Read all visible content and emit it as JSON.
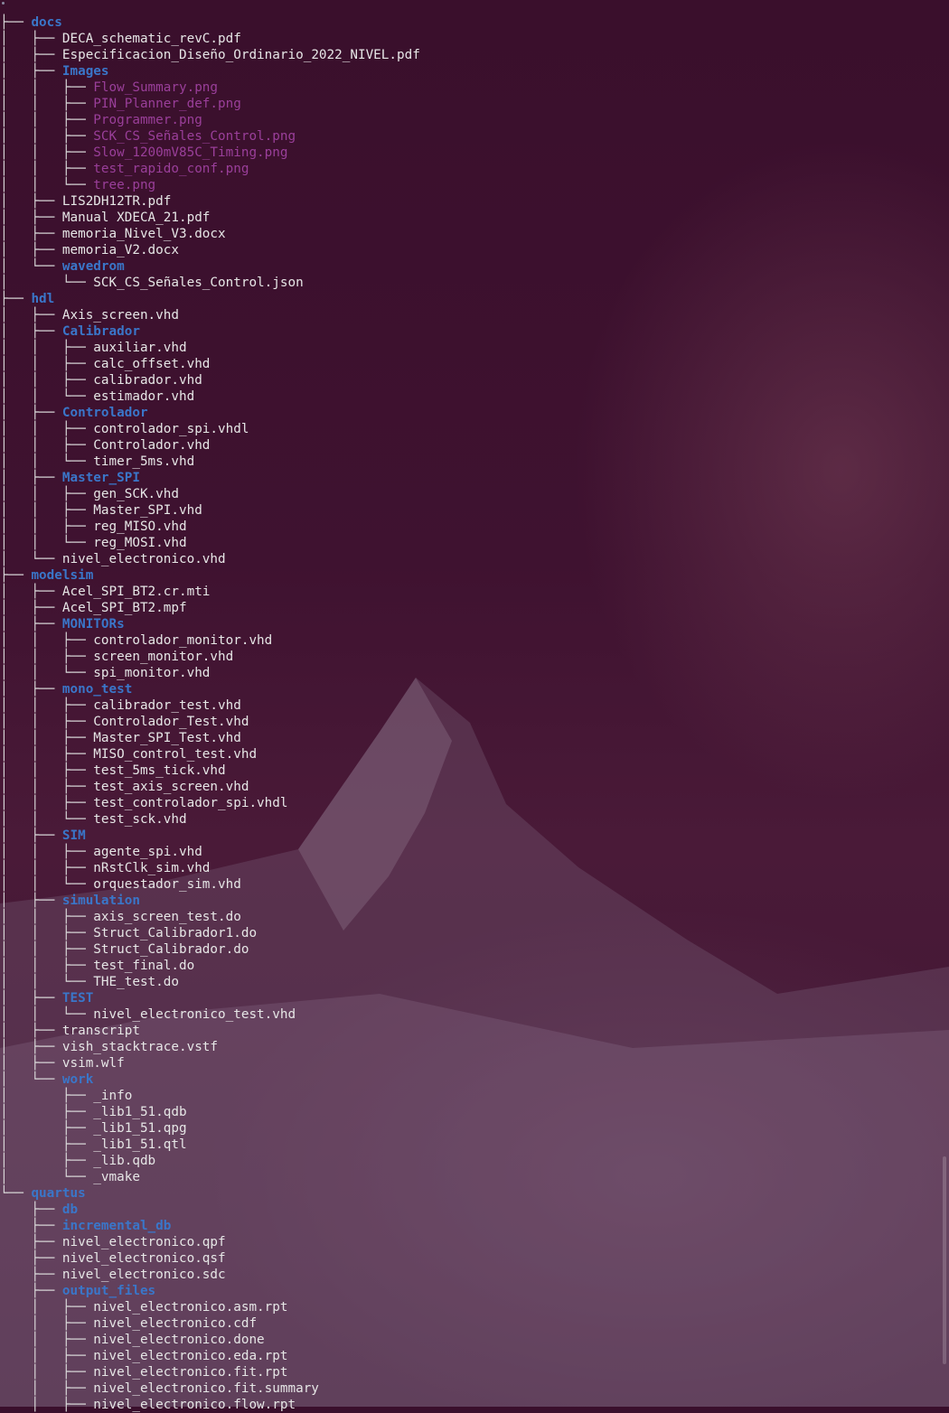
{
  "tree": [
    {
      "prefix": "├── ",
      "name": "docs",
      "kind": "dir"
    },
    {
      "prefix": "│   ├── ",
      "name": "DECA_schematic_revC.pdf",
      "kind": "file"
    },
    {
      "prefix": "│   ├── ",
      "name": "Especificacion_Diseño_Ordinario_2022_NIVEL.pdf",
      "kind": "file"
    },
    {
      "prefix": "│   ├── ",
      "name": "Images",
      "kind": "dir"
    },
    {
      "prefix": "│   │   ├── ",
      "name": "Flow_Summary.png",
      "kind": "img"
    },
    {
      "prefix": "│   │   ├── ",
      "name": "PIN_Planner_def.png",
      "kind": "img"
    },
    {
      "prefix": "│   │   ├── ",
      "name": "Programmer.png",
      "kind": "img"
    },
    {
      "prefix": "│   │   ├── ",
      "name": "SCK_CS_Señales_Control.png",
      "kind": "img"
    },
    {
      "prefix": "│   │   ├── ",
      "name": "Slow_1200mV85C_Timing.png",
      "kind": "img"
    },
    {
      "prefix": "│   │   ├── ",
      "name": "test_rapido_conf.png",
      "kind": "img"
    },
    {
      "prefix": "│   │   └── ",
      "name": "tree.png",
      "kind": "img"
    },
    {
      "prefix": "│   ├── ",
      "name": "LIS2DH12TR.pdf",
      "kind": "file"
    },
    {
      "prefix": "│   ├── ",
      "name": "Manual XDECA_21.pdf",
      "kind": "file"
    },
    {
      "prefix": "│   ├── ",
      "name": "memoria_Nivel_V3.docx",
      "kind": "file"
    },
    {
      "prefix": "│   ├── ",
      "name": "memoria_V2.docx",
      "kind": "file"
    },
    {
      "prefix": "│   └── ",
      "name": "wavedrom",
      "kind": "dir"
    },
    {
      "prefix": "│       └── ",
      "name": "SCK_CS_Señales_Control.json",
      "kind": "file"
    },
    {
      "prefix": "├── ",
      "name": "hdl",
      "kind": "dir"
    },
    {
      "prefix": "│   ├── ",
      "name": "Axis_screen.vhd",
      "kind": "file"
    },
    {
      "prefix": "│   ├── ",
      "name": "Calibrador",
      "kind": "dir"
    },
    {
      "prefix": "│   │   ├── ",
      "name": "auxiliar.vhd",
      "kind": "file"
    },
    {
      "prefix": "│   │   ├── ",
      "name": "calc_offset.vhd",
      "kind": "file"
    },
    {
      "prefix": "│   │   ├── ",
      "name": "calibrador.vhd",
      "kind": "file"
    },
    {
      "prefix": "│   │   └── ",
      "name": "estimador.vhd",
      "kind": "file"
    },
    {
      "prefix": "│   ├── ",
      "name": "Controlador",
      "kind": "dir"
    },
    {
      "prefix": "│   │   ├── ",
      "name": "controlador_spi.vhdl",
      "kind": "file"
    },
    {
      "prefix": "│   │   ├── ",
      "name": "Controlador.vhd",
      "kind": "file"
    },
    {
      "prefix": "│   │   └── ",
      "name": "timer_5ms.vhd",
      "kind": "file"
    },
    {
      "prefix": "│   ├── ",
      "name": "Master_SPI",
      "kind": "dir"
    },
    {
      "prefix": "│   │   ├── ",
      "name": "gen_SCK.vhd",
      "kind": "file"
    },
    {
      "prefix": "│   │   ├── ",
      "name": "Master_SPI.vhd",
      "kind": "file"
    },
    {
      "prefix": "│   │   ├── ",
      "name": "reg_MISO.vhd",
      "kind": "file"
    },
    {
      "prefix": "│   │   └── ",
      "name": "reg_MOSI.vhd",
      "kind": "file"
    },
    {
      "prefix": "│   └── ",
      "name": "nivel_electronico.vhd",
      "kind": "file"
    },
    {
      "prefix": "├── ",
      "name": "modelsim",
      "kind": "dir"
    },
    {
      "prefix": "│   ├── ",
      "name": "Acel_SPI_BT2.cr.mti",
      "kind": "file"
    },
    {
      "prefix": "│   ├── ",
      "name": "Acel_SPI_BT2.mpf",
      "kind": "file"
    },
    {
      "prefix": "│   ├── ",
      "name": "MONITORs",
      "kind": "dir"
    },
    {
      "prefix": "│   │   ├── ",
      "name": "controlador_monitor.vhd",
      "kind": "file"
    },
    {
      "prefix": "│   │   ├── ",
      "name": "screen_monitor.vhd",
      "kind": "file"
    },
    {
      "prefix": "│   │   └── ",
      "name": "spi_monitor.vhd",
      "kind": "file"
    },
    {
      "prefix": "│   ├── ",
      "name": "mono_test",
      "kind": "dir"
    },
    {
      "prefix": "│   │   ├── ",
      "name": "calibrador_test.vhd",
      "kind": "file"
    },
    {
      "prefix": "│   │   ├── ",
      "name": "Controlador_Test.vhd",
      "kind": "file"
    },
    {
      "prefix": "│   │   ├── ",
      "name": "Master_SPI_Test.vhd",
      "kind": "file"
    },
    {
      "prefix": "│   │   ├── ",
      "name": "MISO_control_test.vhd",
      "kind": "file"
    },
    {
      "prefix": "│   │   ├── ",
      "name": "test_5ms_tick.vhd",
      "kind": "file"
    },
    {
      "prefix": "│   │   ├── ",
      "name": "test_axis_screen.vhd",
      "kind": "file"
    },
    {
      "prefix": "│   │   ├── ",
      "name": "test_controlador_spi.vhdl",
      "kind": "file"
    },
    {
      "prefix": "│   │   └── ",
      "name": "test_sck.vhd",
      "kind": "file"
    },
    {
      "prefix": "│   ├── ",
      "name": "SIM",
      "kind": "dir"
    },
    {
      "prefix": "│   │   ├── ",
      "name": "agente_spi.vhd",
      "kind": "file"
    },
    {
      "prefix": "│   │   ├── ",
      "name": "nRstClk_sim.vhd",
      "kind": "file"
    },
    {
      "prefix": "│   │   └── ",
      "name": "orquestador_sim.vhd",
      "kind": "file"
    },
    {
      "prefix": "│   ├── ",
      "name": "simulation",
      "kind": "dir"
    },
    {
      "prefix": "│   │   ├── ",
      "name": "axis_screen_test.do",
      "kind": "file"
    },
    {
      "prefix": "│   │   ├── ",
      "name": "Struct_Calibrador1.do",
      "kind": "file"
    },
    {
      "prefix": "│   │   ├── ",
      "name": "Struct_Calibrador.do",
      "kind": "file"
    },
    {
      "prefix": "│   │   ├── ",
      "name": "test_final.do",
      "kind": "file"
    },
    {
      "prefix": "│   │   └── ",
      "name": "THE_test.do",
      "kind": "file"
    },
    {
      "prefix": "│   ├── ",
      "name": "TEST",
      "kind": "dir"
    },
    {
      "prefix": "│   │   └── ",
      "name": "nivel_electronico_test.vhd",
      "kind": "file"
    },
    {
      "prefix": "│   ├── ",
      "name": "transcript",
      "kind": "file"
    },
    {
      "prefix": "│   ├── ",
      "name": "vish_stacktrace.vstf",
      "kind": "file"
    },
    {
      "prefix": "│   ├── ",
      "name": "vsim.wlf",
      "kind": "file"
    },
    {
      "prefix": "│   └── ",
      "name": "work",
      "kind": "dir"
    },
    {
      "prefix": "│       ├── ",
      "name": "_info",
      "kind": "file"
    },
    {
      "prefix": "│       ├── ",
      "name": "_lib1_51.qdb",
      "kind": "file"
    },
    {
      "prefix": "│       ├── ",
      "name": "_lib1_51.qpg",
      "kind": "file"
    },
    {
      "prefix": "│       ├── ",
      "name": "_lib1_51.qtl",
      "kind": "file"
    },
    {
      "prefix": "│       ├── ",
      "name": "_lib.qdb",
      "kind": "file"
    },
    {
      "prefix": "│       └── ",
      "name": "_vmake",
      "kind": "file"
    },
    {
      "prefix": "└── ",
      "name": "quartus",
      "kind": "dir"
    },
    {
      "prefix": "    ├── ",
      "name": "db",
      "kind": "dir"
    },
    {
      "prefix": "    ├── ",
      "name": "incremental_db",
      "kind": "dir"
    },
    {
      "prefix": "    ├── ",
      "name": "nivel_electronico.qpf",
      "kind": "file"
    },
    {
      "prefix": "    ├── ",
      "name": "nivel_electronico.qsf",
      "kind": "file"
    },
    {
      "prefix": "    ├── ",
      "name": "nivel_electronico.sdc",
      "kind": "file"
    },
    {
      "prefix": "    ├── ",
      "name": "output_files",
      "kind": "dir"
    },
    {
      "prefix": "    │   ├── ",
      "name": "nivel_electronico.asm.rpt",
      "kind": "file"
    },
    {
      "prefix": "    │   ├── ",
      "name": "nivel_electronico.cdf",
      "kind": "file"
    },
    {
      "prefix": "    │   ├── ",
      "name": "nivel_electronico.done",
      "kind": "file"
    },
    {
      "prefix": "    │   ├── ",
      "name": "nivel_electronico.eda.rpt",
      "kind": "file"
    },
    {
      "prefix": "    │   ├── ",
      "name": "nivel_electronico.fit.rpt",
      "kind": "file"
    },
    {
      "prefix": "    │   ├── ",
      "name": "nivel_electronico.fit.summary",
      "kind": "file"
    },
    {
      "prefix": "    │   ├── ",
      "name": "nivel_electronico.flow.rpt",
      "kind": "file"
    }
  ],
  "colors": {
    "dir": "#3a76c9",
    "file": "#e6e6e6",
    "img": "#9a3f9a",
    "background": "#3a0f2c"
  }
}
